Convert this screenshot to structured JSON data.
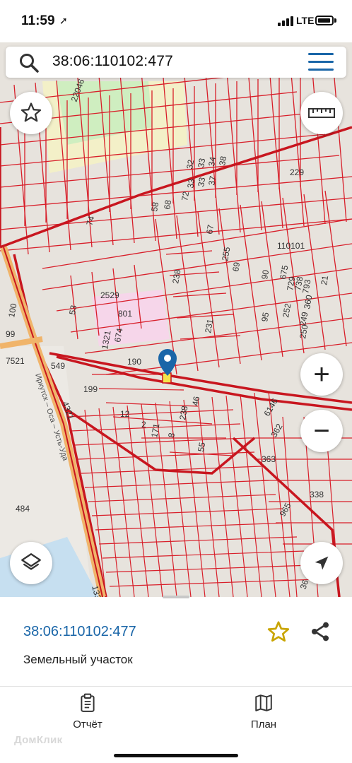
{
  "status_bar": {
    "time": "11:59",
    "network": "LTE"
  },
  "search": {
    "query": "38:06:110102:477"
  },
  "map": {
    "parcel_labels": [
      "22046",
      "74",
      "68",
      "58",
      "32",
      "33",
      "34",
      "38",
      "33",
      "37",
      "33",
      "72",
      "229",
      "67",
      "255",
      "69",
      "110101",
      "90",
      "675",
      "729",
      "738",
      "793",
      "21",
      "2529",
      "238",
      "801",
      "53",
      "95",
      "252",
      "360",
      "249",
      "250",
      "231",
      "674",
      "1321",
      "190",
      "100",
      "99",
      "549",
      "7521",
      "199",
      "4321",
      "12",
      "2",
      "171",
      "238",
      "46",
      "6146",
      "362",
      "8",
      "55",
      "363",
      "338",
      "484",
      "965",
      "1333",
      "36"
    ],
    "cadastral_label": "110101",
    "road_label": "Иркутск – Оса – Усть-Уда"
  },
  "controls": {
    "zoom_in": "+",
    "zoom_out": "−"
  },
  "info_panel": {
    "cadastral_number": "38:06:110102:477",
    "object_type": "Земельный участок"
  },
  "tabs": [
    {
      "label": "Отчёт"
    },
    {
      "label": "План"
    }
  ],
  "branding": {
    "watermark": "ДомКлик"
  },
  "colors": {
    "accent": "#1a66a8",
    "parcel_line": "#d81f2a",
    "favorite_star": "#c9a400",
    "marker": "#1a66a8"
  }
}
